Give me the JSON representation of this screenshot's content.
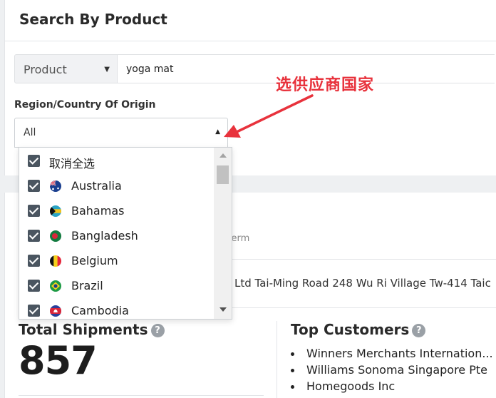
{
  "page": {
    "title": "Search By Product"
  },
  "search": {
    "type_label": "Product",
    "query": "yoga mat"
  },
  "annotation": {
    "text": "选供应商国家",
    "color": "#e8323c"
  },
  "region": {
    "label": "Region/Country Of Origin",
    "selected": "All",
    "deselect_all": "取消全选",
    "options": [
      {
        "name": "Australia",
        "checked": true
      },
      {
        "name": "Bahamas",
        "checked": true
      },
      {
        "name": "Bangladesh",
        "checked": true
      },
      {
        "name": "Belgium",
        "checked": true
      },
      {
        "name": "Brazil",
        "checked": true
      },
      {
        "name": "Cambodia",
        "checked": true
      }
    ]
  },
  "results": {
    "hint_fragment": "n term",
    "address_fragment": "Ltd Tai-Ming Road 248 Wu Ri Village Tw-414 Taic"
  },
  "stats": {
    "total_shipments_label": "Total Shipments",
    "total_shipments_value": "857",
    "top_customers_label": "Top Customers",
    "info_icon": "?",
    "customers": [
      "Winners Merchants Internation...",
      "Williams Sonoma Singapore Pte",
      "Homegoods Inc"
    ]
  },
  "colors": {
    "checkbox": "#4a5560",
    "annotation": "#e8323c"
  }
}
